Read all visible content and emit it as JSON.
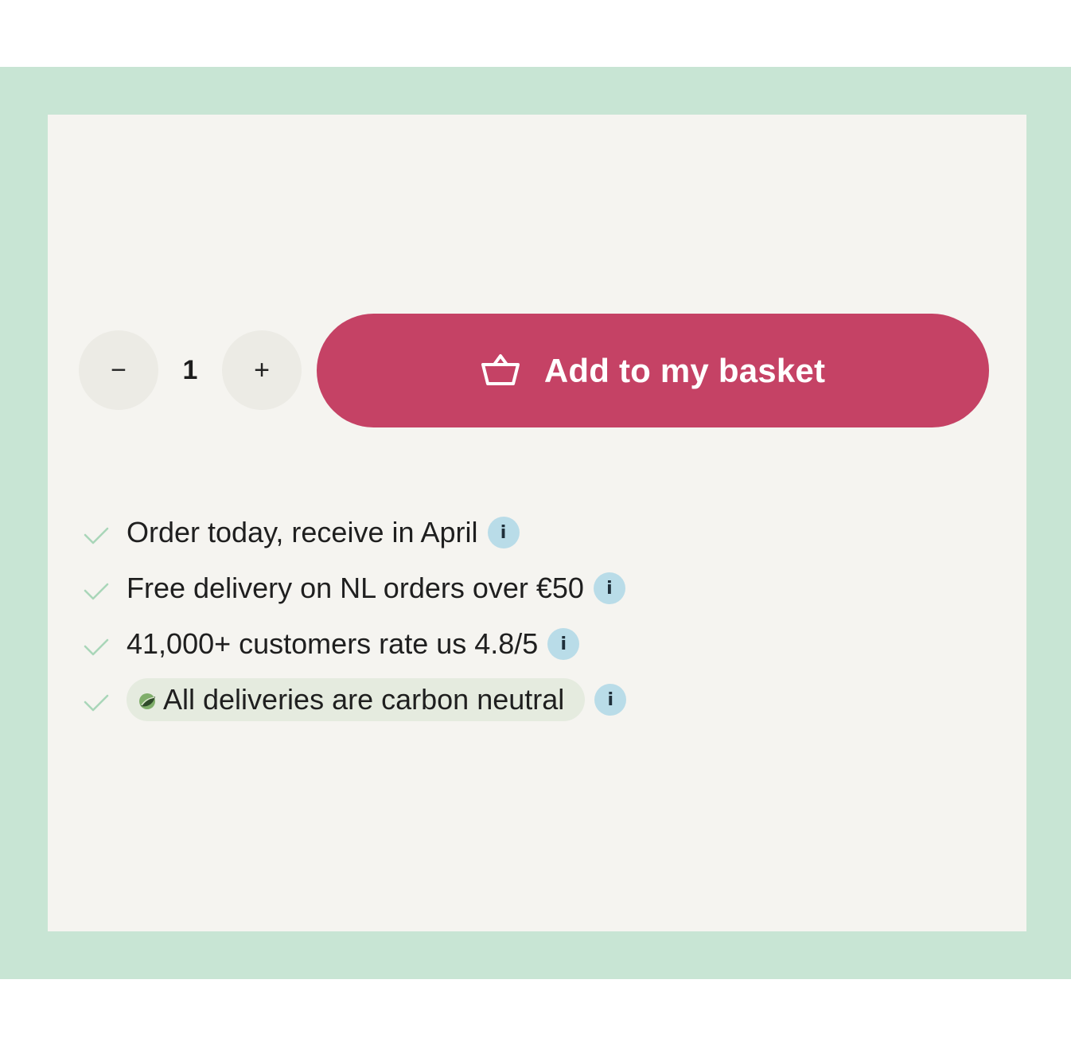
{
  "colors": {
    "outer_background": "#c8e5d4",
    "card_background": "#f5f4f0",
    "stepper_background": "#ecebe5",
    "primary_button": "#c54265",
    "info_badge": "#b9dce8",
    "check": "#a9d6b9",
    "carbon_pill": "#e5ebdf"
  },
  "quantity": {
    "decrement_symbol": "−",
    "value": "1",
    "increment_symbol": "+"
  },
  "add_button": {
    "icon": "basket-icon",
    "label": "Add to my basket"
  },
  "benefits": [
    {
      "text": "Order today, receive in April",
      "icon": "check-icon",
      "info": "i"
    },
    {
      "text": "Free delivery on NL orders over €50",
      "icon": "check-icon",
      "info": "i"
    },
    {
      "text": "41,000+ customers rate us 4.8/5",
      "icon": "check-icon",
      "info": "i"
    },
    {
      "text": "All deliveries are carbon neutral",
      "icon": "check-icon",
      "badge_icon": "leaf-icon",
      "info": "i"
    }
  ]
}
